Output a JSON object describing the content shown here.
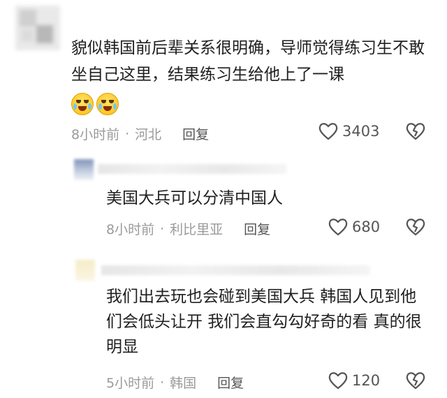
{
  "comment": {
    "text": "貌似韩国前后辈关系很明确，导师觉得练习生不敢坐自己这里，结果练习生给他上了一课",
    "emojis": [
      "crying-laughing-emoji",
      "crying-laughing-emoji"
    ],
    "time": "8小时前",
    "location": "河北",
    "reply_label": "回复",
    "likes": "3403"
  },
  "replies": [
    {
      "text": "美国大兵可以分清中国人",
      "time": "8小时前",
      "location": "利比里亚",
      "reply_label": "回复",
      "likes": "680"
    },
    {
      "text": "我们出去玩也会碰到美国大兵 韩国人见到他们会低头让开 我们会直勾勾好奇的看 真的很明显",
      "time": "5小时前",
      "location": "韩国",
      "reply_label": "回复",
      "likes": "120"
    }
  ],
  "separator": "·",
  "colors": {
    "meta": "#9a9a9a",
    "text": "#1f1f1f",
    "icon": "#555555"
  }
}
